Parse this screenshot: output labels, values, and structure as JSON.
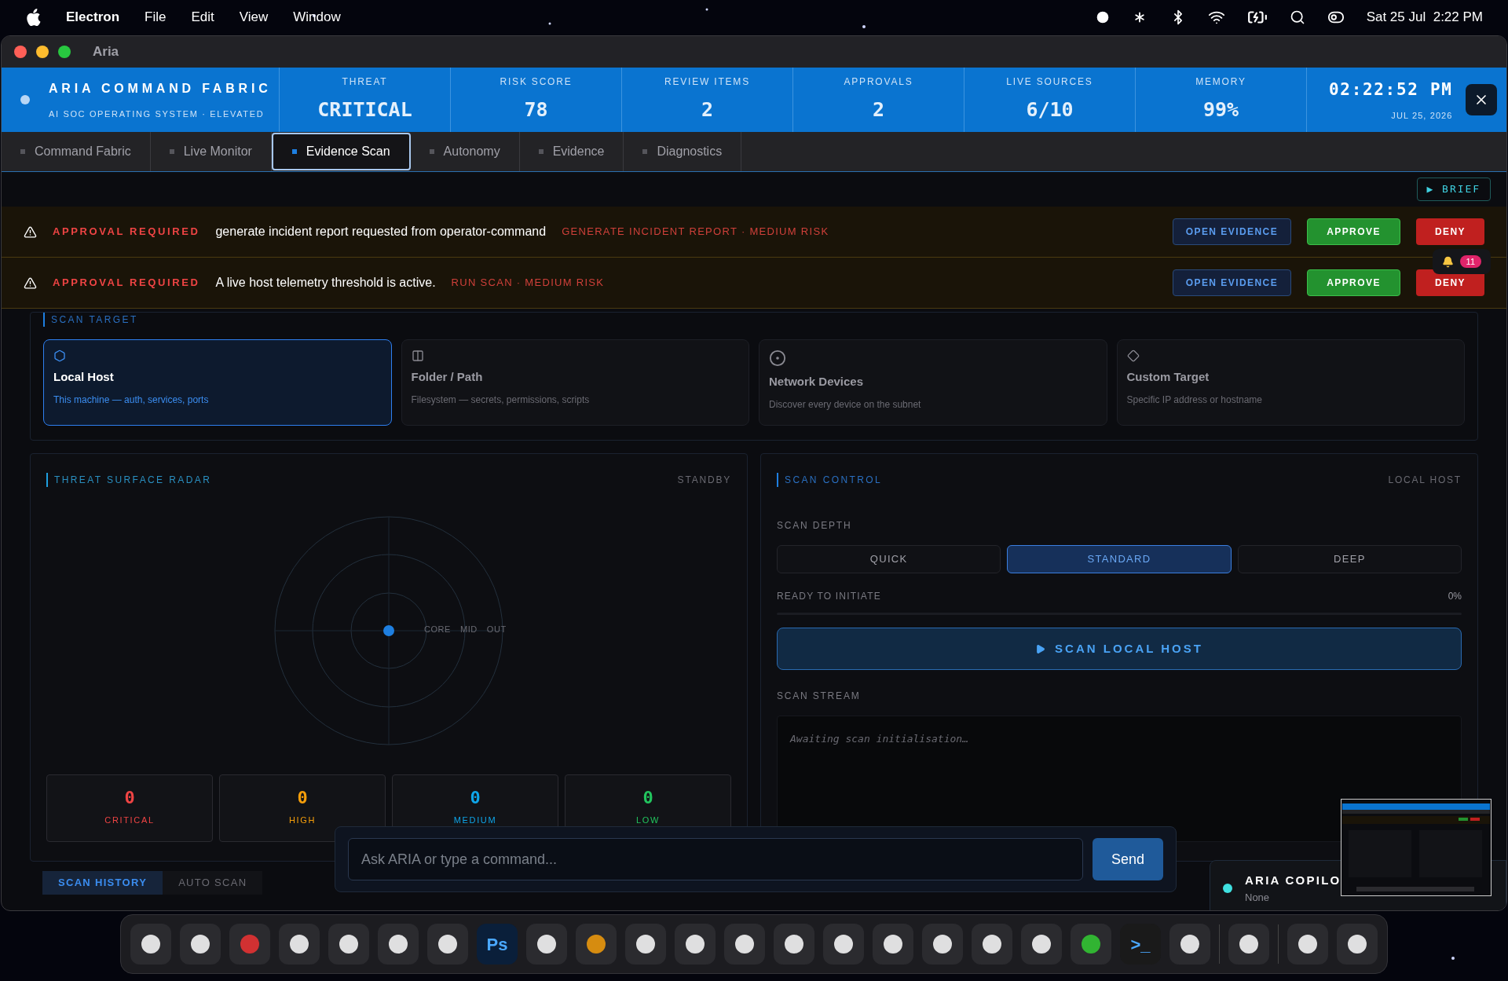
{
  "menu_bar": {
    "app": "Electron",
    "menus": [
      "File",
      "Edit",
      "View",
      "Window"
    ],
    "clock": "Sat 25 Jul  2:22 PM"
  },
  "window": {
    "title": "Aria"
  },
  "header": {
    "title": "ARIA COMMAND FABRIC",
    "subtitle": "AI SOC OPERATING SYSTEM · ELEVATED",
    "time": "02:22:52 PM",
    "date": "JUL 25, 2026",
    "stats": [
      {
        "label": "THREAT",
        "value": "CRITICAL"
      },
      {
        "label": "RISK SCORE",
        "value": "78"
      },
      {
        "label": "REVIEW ITEMS",
        "value": "2"
      },
      {
        "label": "APPROVALS",
        "value": "2"
      },
      {
        "label": "LIVE SOURCES",
        "value": "6/10"
      },
      {
        "label": "MEMORY",
        "value": "99%"
      }
    ]
  },
  "tabs": [
    {
      "label": "Command Fabric",
      "selected": false
    },
    {
      "label": "Live Monitor",
      "selected": false
    },
    {
      "label": "Evidence Scan",
      "selected": true
    },
    {
      "label": "Autonomy",
      "selected": false
    },
    {
      "label": "Evidence",
      "selected": false
    },
    {
      "label": "Diagnostics",
      "selected": false
    }
  ],
  "brief_button": "▶ BRIEF",
  "approvals": [
    {
      "label": "APPROVAL REQUIRED",
      "message": "generate incident report requested from operator-command",
      "meta": "GENERATE INCIDENT REPORT · MEDIUM RISK",
      "open": "OPEN EVIDENCE",
      "approve": "APPROVE",
      "deny": "DENY"
    },
    {
      "label": "APPROVAL REQUIRED",
      "message": "A live host telemetry threshold is active.",
      "meta": "RUN SCAN · MEDIUM RISK",
      "open": "OPEN EVIDENCE",
      "approve": "APPROVE",
      "deny": "DENY"
    }
  ],
  "notifications": {
    "count": "11"
  },
  "scan_target": {
    "title": "SCAN TARGET",
    "targets": [
      {
        "kind": "hexagon",
        "name": "Local Host",
        "description": "This machine — auth, services, ports",
        "selected": true
      },
      {
        "kind": "panel",
        "name": "Folder / Path",
        "description": "Filesystem — secrets, permissions, scripts",
        "selected": false
      },
      {
        "kind": "rings",
        "name": "Network Devices",
        "description": "Discover every device on the subnet",
        "selected": false
      },
      {
        "kind": "diamond",
        "name": "Custom Target",
        "description": "Specific IP address or hostname",
        "selected": false
      }
    ]
  },
  "radar": {
    "title": "THREAT SURFACE RADAR",
    "status": "STANDBY",
    "rings": [
      "CORE",
      "MID",
      "OUT"
    ],
    "counts": [
      {
        "value": "0",
        "label": "CRITICAL",
        "color": "#ef4444"
      },
      {
        "value": "0",
        "label": "HIGH",
        "color": "#f59e0b"
      },
      {
        "value": "0",
        "label": "MEDIUM",
        "color": "#0ea5e9"
      },
      {
        "value": "0",
        "label": "LOW",
        "color": "#22c55e"
      }
    ]
  },
  "scan_control": {
    "title": "SCAN CONTROL",
    "target": "LOCAL HOST",
    "depth_label": "SCAN DEPTH",
    "depths": [
      {
        "label": "QUICK",
        "selected": false
      },
      {
        "label": "STANDARD",
        "selected": true
      },
      {
        "label": "DEEP",
        "selected": false
      }
    ],
    "progress_label": "READY TO INITIATE",
    "progress_reading": "0%",
    "level": 0,
    "scan_button": "SCAN LOCAL HOST",
    "stream_label": "SCAN STREAM",
    "stream_placeholder": "Awaiting scan initialisation…"
  },
  "history_tabs": [
    {
      "label": "SCAN HISTORY",
      "selected": true
    },
    {
      "label": "AUTO SCAN",
      "selected": false
    }
  ],
  "chat": {
    "placeholder": "Ask ARIA or type a command...",
    "send": "Send"
  },
  "copilot": {
    "title": "ARIA COPILO",
    "status": "None"
  },
  "dock": {
    "text_icons": [
      "Ps",
      ">_"
    ]
  }
}
